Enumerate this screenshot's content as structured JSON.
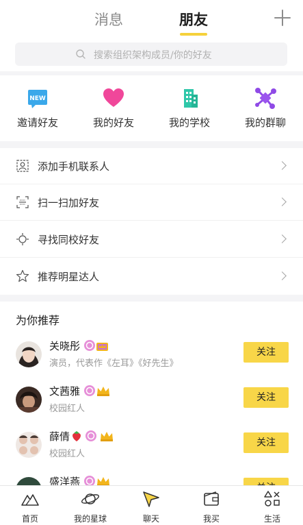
{
  "header": {
    "tabs": [
      {
        "label": "消息",
        "active": false
      },
      {
        "label": "朋友",
        "active": true
      }
    ],
    "add_icon": "plus-icon"
  },
  "search": {
    "placeholder": "搜索组织架构成员/你的好友",
    "icon": "search-icon"
  },
  "quick_actions": [
    {
      "label": "邀请好友",
      "icon": "new-badge-icon",
      "color": "#38a7e8"
    },
    {
      "label": "我的好友",
      "icon": "heart-icon",
      "color": "#f0479a"
    },
    {
      "label": "我的学校",
      "icon": "building-icon",
      "color": "#2fc7a9"
    },
    {
      "label": "我的群聊",
      "icon": "network-icon",
      "color": "#8f4ae6"
    }
  ],
  "menu_list": [
    {
      "label": "添加手机联系人",
      "icon": "contact-card-icon"
    },
    {
      "label": "扫一扫加好友",
      "icon": "scan-icon"
    },
    {
      "label": "寻找同校好友",
      "icon": "locate-icon"
    },
    {
      "label": "推荐明星达人",
      "icon": "star-icon"
    }
  ],
  "recommend": {
    "title": "为你推荐",
    "follow_label": "关注",
    "people": [
      {
        "name": "关晓彤",
        "desc": "演员，代表作《左耳》《好先生》"
      },
      {
        "name": "文茜雅",
        "desc": "校园红人"
      },
      {
        "name": "薛倩",
        "desc": "校园红人"
      },
      {
        "name": "盛洋燕",
        "desc": ""
      }
    ]
  },
  "bottom_nav": [
    {
      "label": "首页",
      "icon": "mountain-icon",
      "active": false
    },
    {
      "label": "我的星球",
      "icon": "planet-icon",
      "active": false
    },
    {
      "label": "聊天",
      "icon": "paper-plane-icon",
      "active": true
    },
    {
      "label": "我买",
      "icon": "wallet-icon",
      "active": false
    },
    {
      "label": "生活",
      "icon": "apps-icon",
      "active": false
    }
  ],
  "colors": {
    "accent": "#f8d648",
    "tab_underline": "#f5d13b",
    "badge_pink": "#e68fd8",
    "crown_gold": "#f2b51c"
  }
}
